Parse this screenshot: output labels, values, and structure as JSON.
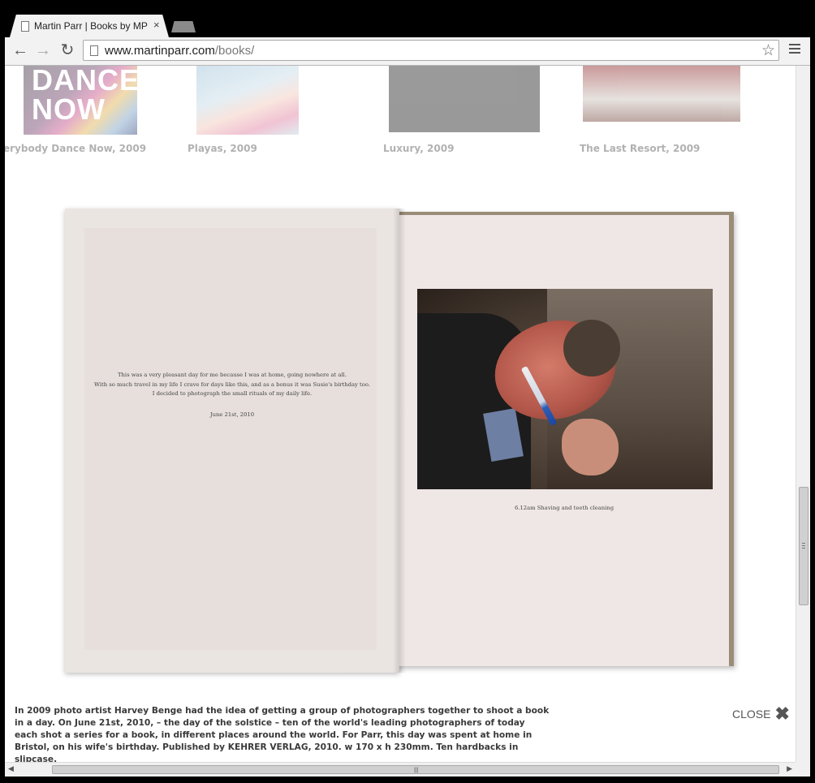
{
  "browser": {
    "tab_title": "Martin Parr | Books by MP",
    "tab_close": "×",
    "url_host": "www.martinparr.com",
    "url_path": "/books/"
  },
  "thumbnails": [
    {
      "label": "erybody Dance Now, 2009",
      "cover_text": "DANCE\nNOW"
    },
    {
      "label": "Playas, 2009"
    },
    {
      "label": "Luxury, 2009"
    },
    {
      "label": "The Last Resort, 2009"
    }
  ],
  "book": {
    "left_page_lines": [
      "This was a very pleasant day for me because I was at home, going nowhere at all.",
      "With so much travel in my life I crave for days like this, and as a bonus it was Susie's birthday too.",
      "I decided to photograph the small rituals of my daily life."
    ],
    "left_page_date": "June 21st, 2010",
    "caption": "6.12am  Shaving and teeth cleaning"
  },
  "description": "In 2009 photo artist Harvey Benge had the idea of getting a group of photographers together to shoot a book in a day. On June 21st, 2010, – the day of the solstice – ten of the world's leading photographers of today each shot a series for a book, in different places around the world. For Parr, this day was spent at home in Bristol, on his wife's birthday. Published by KEHRER VERLAG, 2010. w 170 x h 230mm. Ten hardbacks in slipcase.",
  "close_label": "CLOSE",
  "icons": {
    "back": "back-arrow-icon",
    "forward": "forward-arrow-icon",
    "reload": "reload-icon",
    "star": "star-icon",
    "menu": "hamburger-menu-icon",
    "close": "close-x-icon"
  }
}
